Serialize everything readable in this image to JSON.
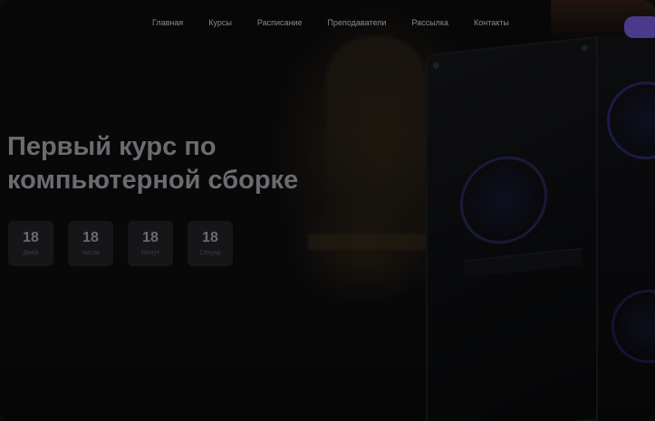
{
  "nav": {
    "items": [
      {
        "label": "Главная"
      },
      {
        "label": "Курсы"
      },
      {
        "label": "Расписание"
      },
      {
        "label": "Преподаватели"
      },
      {
        "label": "Рассылка"
      },
      {
        "label": "Контакты"
      }
    ]
  },
  "hero": {
    "title": "Первый курс по компьютерной сборке"
  },
  "countdown": [
    {
      "value": "18",
      "unit": "Дней"
    },
    {
      "value": "18",
      "unit": "Часов"
    },
    {
      "value": "18",
      "unit": "Минут"
    },
    {
      "value": "18",
      "unit": "Секунд"
    }
  ],
  "colors": {
    "accent": "#4a3a8c",
    "overlay": "#000000"
  }
}
